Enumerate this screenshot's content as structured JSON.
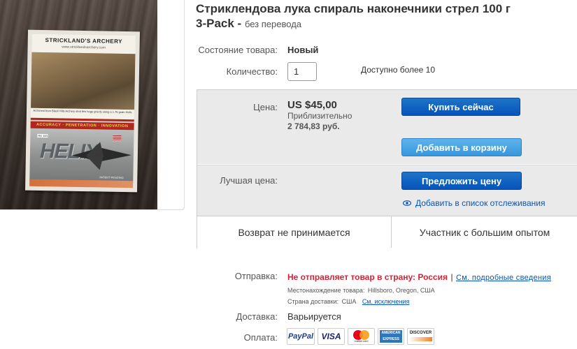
{
  "listing": {
    "title": "Стриклендова лука спираль наконечники стрел 100 г",
    "title_line2": "3-Pack - ",
    "title_note": "без перевода"
  },
  "photo": {
    "brand": "STRICKLAND'S ARCHERY",
    "url": "www.stricklandsarchery.com",
    "caption": "At Ernest from Black Hills Archery shot this huge grizzly using a 1.75 grain Helix",
    "band": "ACCURACY · PENETRATION · INNOVATION",
    "product": "HELIX",
    "tag": "HX 100",
    "patent": "PATENT PENDING"
  },
  "condition": {
    "label": "Состояние товара:",
    "value": "Новый"
  },
  "quantity": {
    "label": "Количество:",
    "value": "1",
    "available": "Доступно более 10"
  },
  "price": {
    "label": "Цена:",
    "value": "US $45,00",
    "approx_label": "Приблизительно",
    "approx_value": "2 784,83 руб.",
    "buy_button": "Купить сейчас",
    "cart_button": "Добавить в корзину"
  },
  "best_offer": {
    "label": "Лучшая цена:",
    "offer_button": "Предложить цену",
    "watch_link": "Добавить в список отслеживания"
  },
  "panel_bottom": {
    "returns": "Возврат не принимается",
    "seller": "Участник с большим опытом"
  },
  "shipping": {
    "label": "Отправка:",
    "warning": "Не отправляет товар в страну: Россия",
    "separator": "|",
    "details_link": "См. подробные сведения",
    "location_label": "Местонахождение товара:",
    "location_value": "Hillsboro, Oregon, США",
    "ships_to_label": "Страна доставки:",
    "ships_to_value": "США",
    "exclusions_link": "См. исключения"
  },
  "delivery": {
    "label": "Доставка:",
    "value": "Варьируется"
  },
  "payment": {
    "label": "Оплата:",
    "methods": [
      "PayPal",
      "VISA",
      "mastercard",
      "AMERICAN EXPRESS",
      "DISCOVER"
    ]
  },
  "colors": {
    "ebay_blue": "#0654ba",
    "warning_red": "#dd1e31",
    "panel_gray": "#eaeaea"
  }
}
